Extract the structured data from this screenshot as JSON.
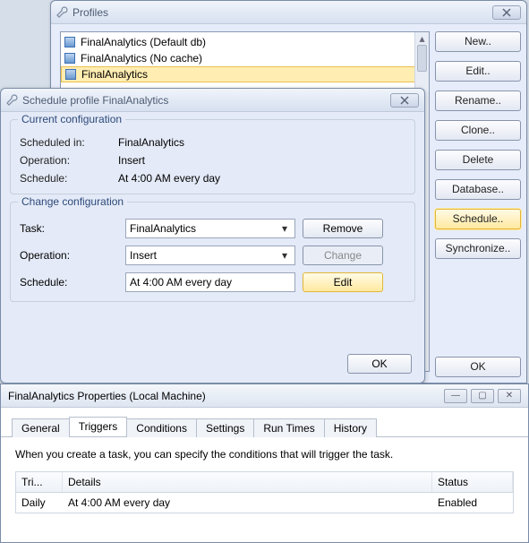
{
  "profiles_window": {
    "title": "Profiles",
    "items": [
      {
        "label": "FinalAnalytics (Default db)"
      },
      {
        "label": "FinalAnalytics (No cache)"
      },
      {
        "label": "FinalAnalytics"
      }
    ],
    "selected_index": 2,
    "buttons": {
      "new": "New..",
      "edit": "Edit..",
      "rename": "Rename..",
      "clone": "Clone..",
      "delete": "Delete",
      "database": "Database..",
      "schedule": "Schedule..",
      "synchronize": "Synchronize..",
      "ok": "OK"
    }
  },
  "schedule_dialog": {
    "title": "Schedule profile FinalAnalytics",
    "current": {
      "legend": "Current configuration",
      "scheduled_in_label": "Scheduled in:",
      "scheduled_in_value": "FinalAnalytics",
      "operation_label": "Operation:",
      "operation_value": "Insert",
      "schedule_label": "Schedule:",
      "schedule_value": "At 4:00 AM every day"
    },
    "change": {
      "legend": "Change configuration",
      "task_label": "Task:",
      "task_value": "FinalAnalytics",
      "operation_label": "Operation:",
      "operation_value": "Insert",
      "schedule_label": "Schedule:",
      "schedule_value": "At 4:00 AM every day",
      "remove_btn": "Remove",
      "change_btn": "Change",
      "edit_btn": "Edit"
    },
    "ok": "OK"
  },
  "properties_window": {
    "title": "FinalAnalytics Properties (Local Machine)",
    "tabs": {
      "general": "General",
      "triggers": "Triggers",
      "conditions": "Conditions",
      "settings": "Settings",
      "run_times": "Run Times",
      "history": "History"
    },
    "active_tab": "triggers",
    "description": "When you create a task, you can specify the conditions that will trigger the task.",
    "table": {
      "col_trigger": "Tri...",
      "col_details": "Details",
      "col_status": "Status",
      "rows": [
        {
          "trigger": "Daily",
          "details": "At 4:00 AM every day",
          "status": "Enabled"
        }
      ]
    }
  }
}
